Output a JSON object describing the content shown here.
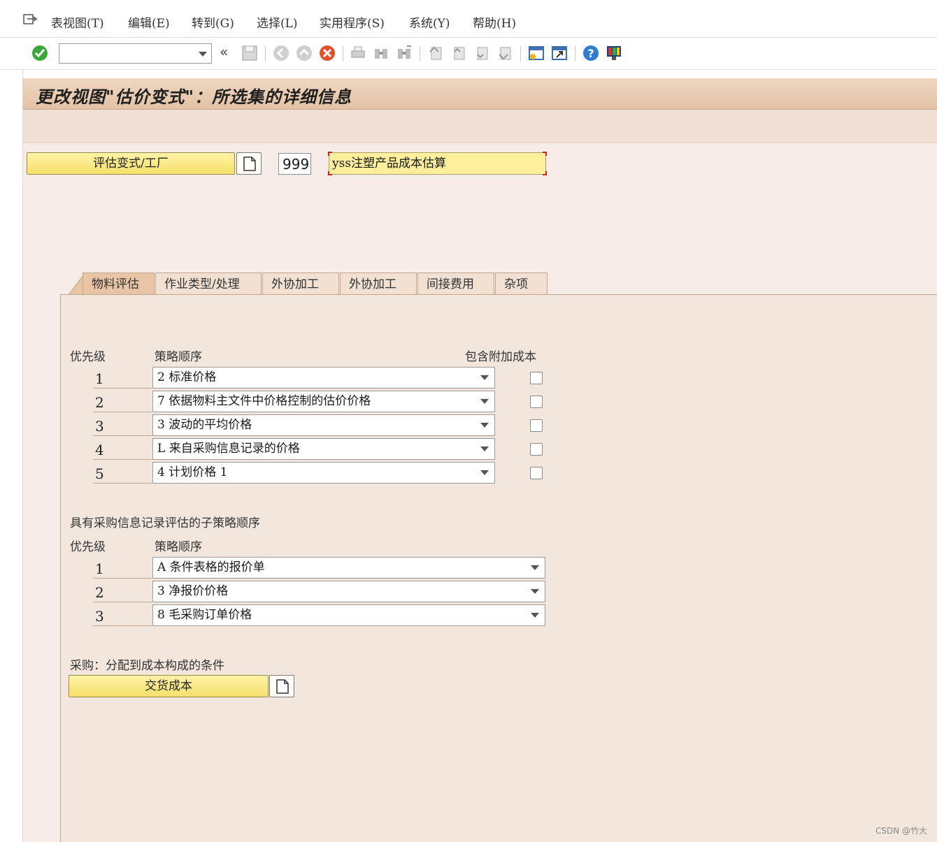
{
  "menu": {
    "items": [
      "表视图(T)",
      "编辑(E)",
      "转到(G)",
      "选择(L)",
      "实用程序(S)",
      "系统(Y)",
      "帮助(H)"
    ]
  },
  "toolbar": {
    "command_field_value": "",
    "icons": [
      "check-icon",
      "back-double-icon",
      "save-icon",
      "back-icon",
      "exit-icon",
      "cancel-icon",
      "print-icon",
      "find-icon",
      "find-next-icon",
      "first-page-icon",
      "prev-page-icon",
      "next-page-icon",
      "last-page-icon",
      "new-session-icon",
      "shortcut-icon",
      "help-icon",
      "layout-icon"
    ]
  },
  "title": "更改视图\"估价变式\"：所选集的详细信息",
  "header": {
    "variant_button_label": "评估变式/工厂",
    "variant_code": "999",
    "variant_desc": "yss注塑产品成本估算"
  },
  "tabs": [
    "物料评估",
    "作业类型/处理",
    "外协加工",
    "外协加工",
    "间接费用",
    "杂项"
  ],
  "active_tab": "物料评估",
  "strategy": {
    "priority_header": "优先级",
    "sequence_header": "策略顺序",
    "addon_header": "包含附加成本",
    "rows": [
      {
        "priority": "1",
        "value": "2 标准价格",
        "checked": false
      },
      {
        "priority": "2",
        "value": "7 依据物料主文件中价格控制的估价价格",
        "checked": false
      },
      {
        "priority": "3",
        "value": "3 波动的平均价格",
        "checked": false
      },
      {
        "priority": "4",
        "value": "L 来自采购信息记录的价格",
        "checked": false
      },
      {
        "priority": "5",
        "value": "4 计划价格 1",
        "checked": false
      }
    ]
  },
  "sub_strategy": {
    "section_title": "具有采购信息记录评估的子策略顺序",
    "priority_header": "优先级",
    "sequence_header": "策略顺序",
    "rows": [
      {
        "priority": "1",
        "value": "A 条件表格的报价单"
      },
      {
        "priority": "2",
        "value": "3 净报价价格"
      },
      {
        "priority": "3",
        "value": "8 毛采购订单价格"
      }
    ]
  },
  "purchasing": {
    "section_title": "采购：分配到成本构成的条件",
    "button_label": "交货成本"
  },
  "watermark": "CSDN @竹大"
}
